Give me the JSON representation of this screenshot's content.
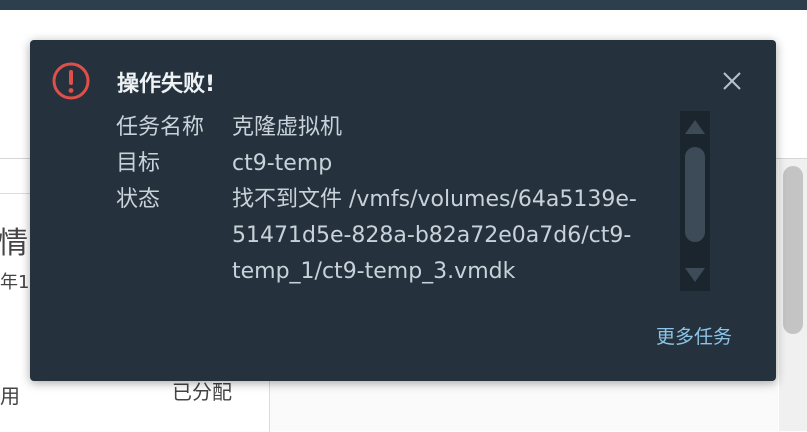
{
  "background": {
    "card_title": "情",
    "card_date": "年1",
    "left_label": "用",
    "right_label": "已分配"
  },
  "toast": {
    "title": "操作失败!",
    "icon": "error-exclamation-icon",
    "close_icon": "close-icon",
    "rows": [
      {
        "label": "任务名称",
        "value_lines": [
          "克隆虚拟机"
        ]
      },
      {
        "label": "目标",
        "value_lines": [
          "ct9-temp"
        ]
      },
      {
        "label": "状态",
        "value_lines": [
          "找不到文件 /vmfs/volumes/64a5139e-",
          "51471d5e-828a-b82a72e0a7d6/ct9-",
          "temp_1/ct9-temp_3.vmdk"
        ]
      }
    ],
    "more_link": "更多任务"
  },
  "colors": {
    "toast_bg": "#25323d",
    "error_red": "#e0504a",
    "link_blue": "#8cc4e8"
  }
}
